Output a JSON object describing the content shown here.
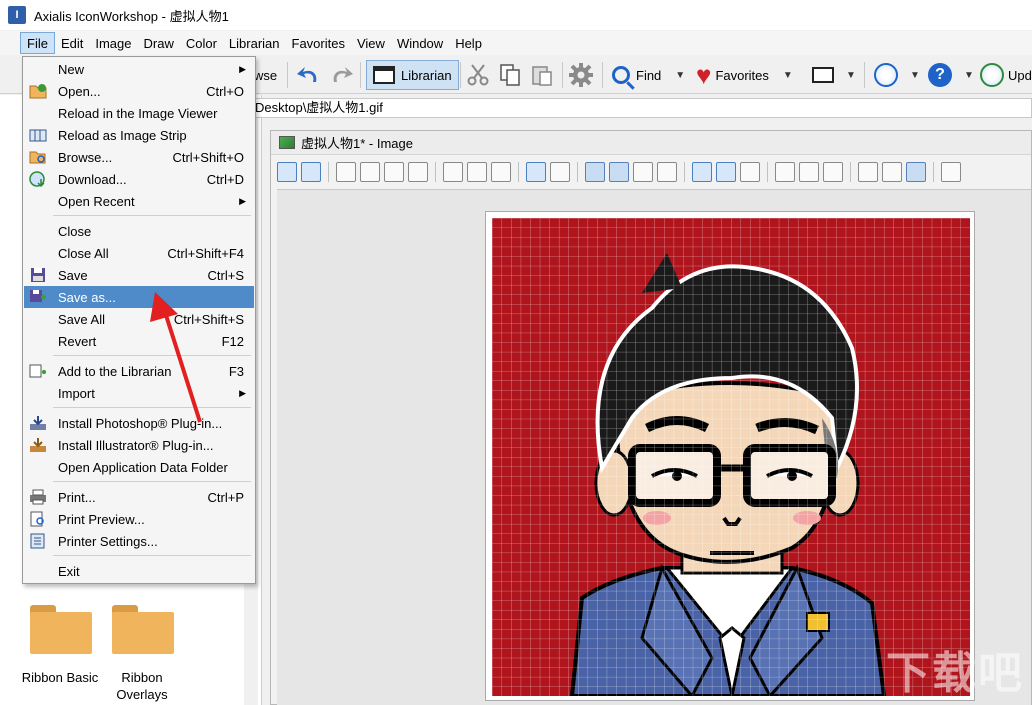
{
  "window": {
    "title": "Axialis IconWorkshop - 虚拟人物1",
    "app_icon_letter": "I"
  },
  "menubar": [
    "File",
    "Edit",
    "Image",
    "Draw",
    "Color",
    "Librarian",
    "Favorites",
    "View",
    "Window",
    "Help"
  ],
  "toolbar": {
    "browse_partial": "wse",
    "librarian": "Librarian",
    "find": "Find",
    "favorites": "Favorites",
    "update_partial": "Upd"
  },
  "path_bar": "Desktop\\虚拟人物1.gif",
  "doc_window": {
    "title": "虚拟人物1* - Image"
  },
  "file_menu": {
    "items": [
      {
        "label": "New",
        "shortcut": "",
        "submenu": true,
        "icon": "none"
      },
      {
        "label": "Open...",
        "shortcut": "Ctrl+O",
        "submenu": false,
        "icon": "open-folder-icon"
      },
      {
        "label": "Reload in the Image Viewer",
        "shortcut": "",
        "submenu": false,
        "icon": "none"
      },
      {
        "label": "Reload as Image Strip",
        "shortcut": "",
        "submenu": false,
        "icon": "image-strip-icon"
      },
      {
        "label": "Browse...",
        "shortcut": "Ctrl+Shift+O",
        "submenu": false,
        "icon": "browse-icon"
      },
      {
        "label": "Download...",
        "shortcut": "Ctrl+D",
        "submenu": false,
        "icon": "download-globe-icon"
      },
      {
        "label": "Open Recent",
        "shortcut": "",
        "submenu": true,
        "icon": "none"
      },
      {
        "label": "Close",
        "shortcut": "",
        "submenu": false,
        "icon": "none"
      },
      {
        "label": "Close All",
        "shortcut": "Ctrl+Shift+F4",
        "submenu": false,
        "icon": "none"
      },
      {
        "label": "Save",
        "shortcut": "Ctrl+S",
        "submenu": false,
        "icon": "floppy-icon"
      },
      {
        "label": "Save as...",
        "shortcut": "",
        "submenu": false,
        "icon": "save-as-icon"
      },
      {
        "label": "Save All",
        "shortcut": "Ctrl+Shift+S",
        "submenu": false,
        "icon": "none"
      },
      {
        "label": "Revert",
        "shortcut": "F12",
        "submenu": false,
        "icon": "none"
      },
      {
        "label": "Add to the Librarian",
        "shortcut": "F3",
        "submenu": false,
        "icon": "add-librarian-icon"
      },
      {
        "label": "Import",
        "shortcut": "",
        "submenu": true,
        "icon": "none"
      },
      {
        "label": "Install Photoshop® Plug-in...",
        "shortcut": "",
        "submenu": false,
        "icon": "install-icon"
      },
      {
        "label": "Install Illustrator® Plug-in...",
        "shortcut": "",
        "submenu": false,
        "icon": "install-icon"
      },
      {
        "label": "Open Application Data Folder",
        "shortcut": "",
        "submenu": false,
        "icon": "none"
      },
      {
        "label": "Print...",
        "shortcut": "Ctrl+P",
        "submenu": false,
        "icon": "printer-icon"
      },
      {
        "label": "Print Preview...",
        "shortcut": "",
        "submenu": false,
        "icon": "print-preview-icon"
      },
      {
        "label": "Printer Settings...",
        "shortcut": "",
        "submenu": false,
        "icon": "printer-settings-icon"
      },
      {
        "label": "Exit",
        "shortcut": "",
        "submenu": false,
        "icon": "none"
      }
    ],
    "highlighted_item": "Save as..."
  },
  "library_folders": [
    {
      "label_line1": "Ribbon Basic",
      "label_line2": ""
    },
    {
      "label_line1": "Ribbon",
      "label_line2": "Overlays"
    }
  ],
  "colors": {
    "canvas_bg": "#b0141c",
    "highlight": "#4f8ac9",
    "arrow": "#e22020",
    "suit": "#4a63a6"
  },
  "watermark": "下载吧"
}
